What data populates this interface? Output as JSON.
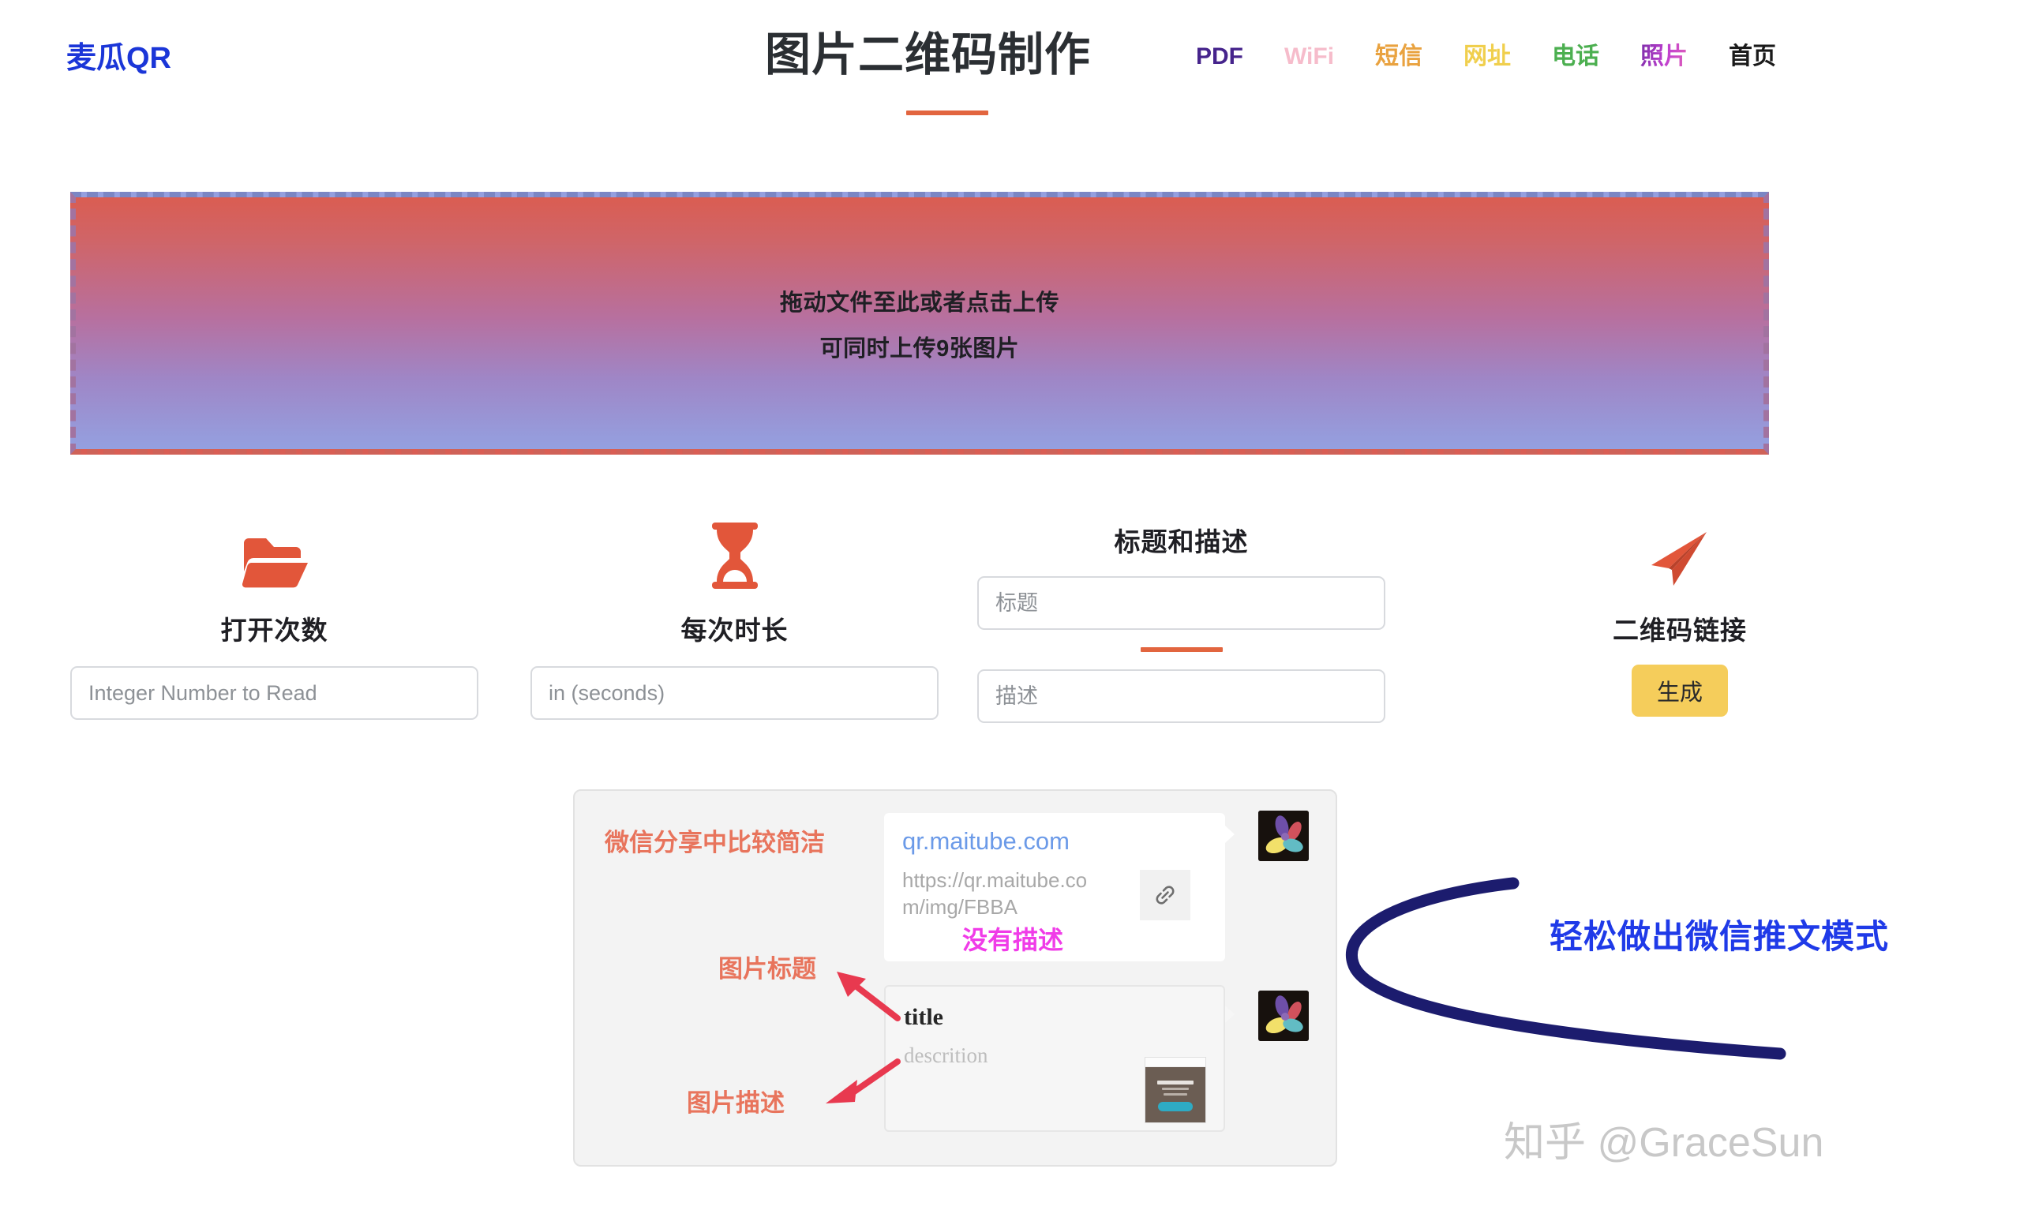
{
  "header": {
    "logo": "麦瓜QR",
    "title": "图片二维码制作",
    "nav": [
      {
        "label": "PDF",
        "color": "#46248c",
        "cls": "nav-pdf"
      },
      {
        "label": "WiFi",
        "color": "#f6bccb",
        "cls": "nav-wifi"
      },
      {
        "label": "短信",
        "color": "#e9a23f",
        "cls": "nav-sms"
      },
      {
        "label": "网址",
        "color": "#f0cf4d",
        "cls": "nav-url"
      },
      {
        "label": "电话",
        "color": "#4caf50",
        "cls": "nav-phone"
      },
      {
        "label": "照片",
        "color": "#c03fd0",
        "cls": "nav-photo"
      },
      {
        "label": "首页",
        "color": "#1a1a1a",
        "cls": "nav-home"
      }
    ]
  },
  "dropzone": {
    "line1": "拖动文件至此或者点击上传",
    "line2": "可同时上传9张图片",
    "gradient_top": "#da5d52",
    "gradient_bottom": "#94a0e0"
  },
  "form": {
    "open_count": {
      "icon": "folder-open-icon",
      "label": "打开次数",
      "placeholder": "Integer Number to Read",
      "value": ""
    },
    "duration": {
      "icon": "hourglass-icon",
      "label": "每次时长",
      "placeholder": "in (seconds)",
      "value": ""
    },
    "title_desc": {
      "heading": "标题和描述",
      "title_placeholder": "标题",
      "title_value": "",
      "desc_placeholder": "描述",
      "desc_value": ""
    },
    "generate": {
      "icon": "paper-plane-icon",
      "label": "二维码链接",
      "button": "生成",
      "button_color": "#f5cd5b"
    },
    "accent_color": "#e2653f"
  },
  "preview": {
    "annotations": {
      "wechat_simple": "微信分享中比较简洁",
      "image_title": "图片标题",
      "image_desc": "图片描述",
      "no_desc": "没有描述",
      "anno_color": "#e8745c",
      "no_desc_color": "#f03ce8",
      "arrow_color": "#e8394f"
    },
    "card_link": {
      "domain": "qr.maitube.com",
      "url": "https://qr.maitube.com/img/FBBA",
      "link_icon": "chain-link-icon"
    },
    "card_article": {
      "title": "title",
      "description": "descrition"
    }
  },
  "handwriting": {
    "text": "轻松做出微信推文模式",
    "text_color": "#1f3ae8",
    "arc_color": "#1c1c6e"
  },
  "watermark": "知乎 @GraceSun"
}
